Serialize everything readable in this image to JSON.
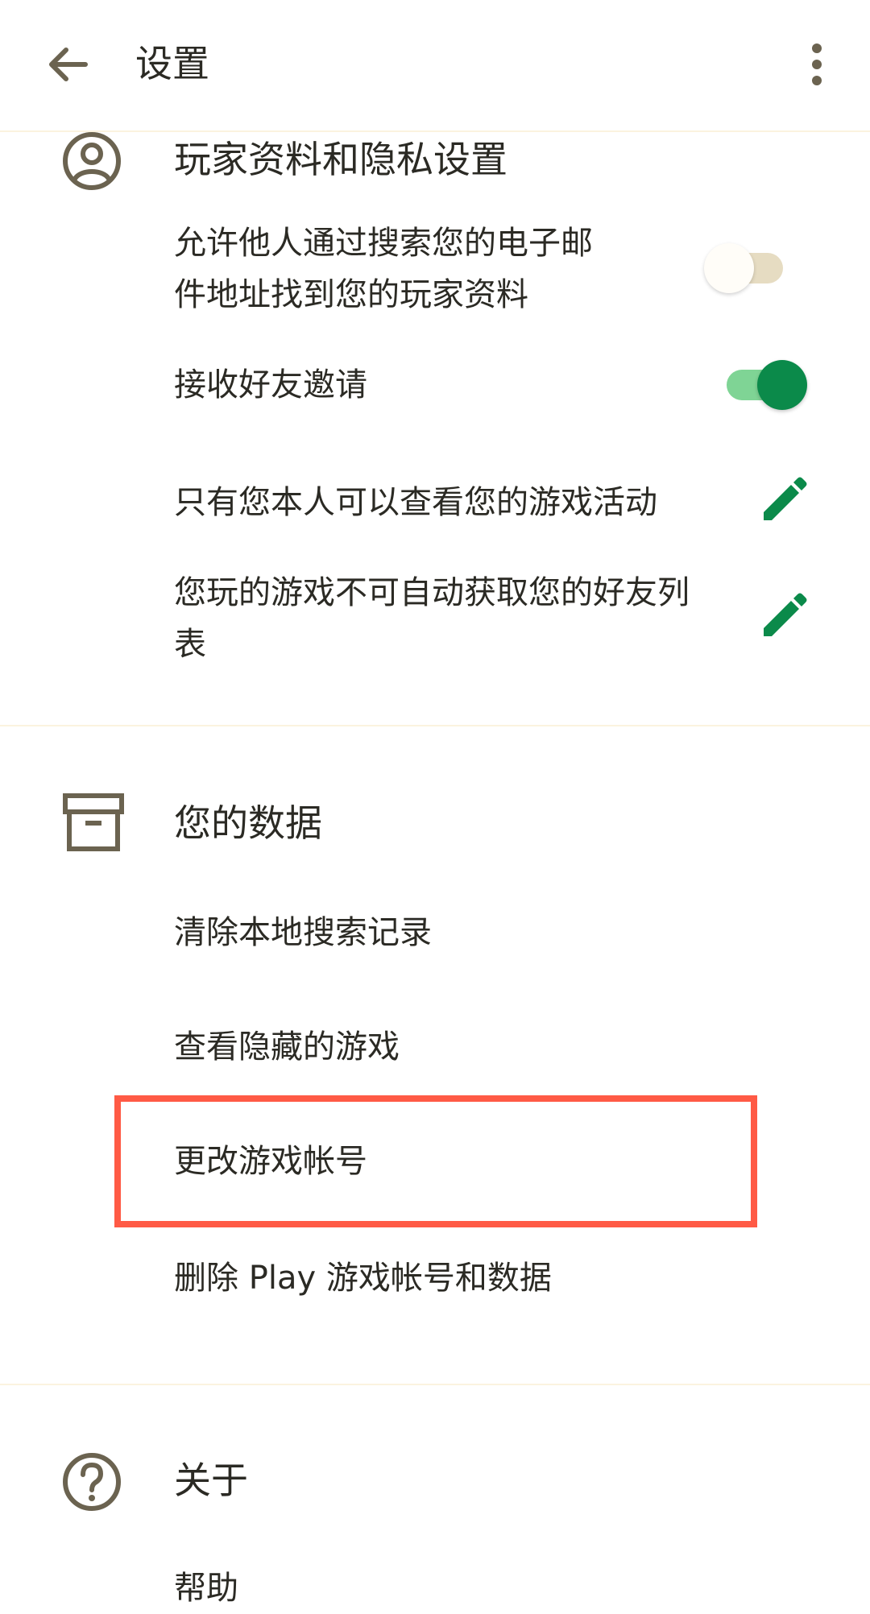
{
  "appbar": {
    "title": "设置",
    "back_icon": "arrow-left-icon",
    "more_icon": "more-vertical-icon"
  },
  "profile_section": {
    "icon": "account-circle-icon",
    "title": "玩家资料和隐私设置",
    "items": [
      {
        "label_line1": "允许他人通过搜索您的电子邮",
        "label_line2": "件地址找到您的玩家资料",
        "control": "toggle",
        "on": false
      },
      {
        "label": "接收好友邀请",
        "control": "toggle",
        "on": true
      },
      {
        "label": "只有您本人可以查看您的游戏活动",
        "control": "edit"
      },
      {
        "label_line1": "您玩的游戏不可自动获取您的好友列",
        "label_line2": "表",
        "control": "edit"
      }
    ]
  },
  "data_section": {
    "icon": "archive-box-icon",
    "title": "您的数据",
    "items": [
      {
        "label": "清除本地搜索记录"
      },
      {
        "label": "查看隐藏的游戏"
      },
      {
        "label": "更改游戏帐号",
        "highlighted": true
      },
      {
        "label": "删除 Play 游戏帐号和数据"
      }
    ]
  },
  "about_section": {
    "icon": "help-circle-icon",
    "title": "关于",
    "items": [
      {
        "label": "帮助"
      }
    ]
  },
  "colors": {
    "accent_green": "#0b8a4a",
    "toggle_on_track": "#7fd495",
    "toggle_off_track": "#e6dcc2",
    "icon_color": "#6b6350",
    "highlight_red": "#ff5a45",
    "divider": "#fbf3df"
  }
}
